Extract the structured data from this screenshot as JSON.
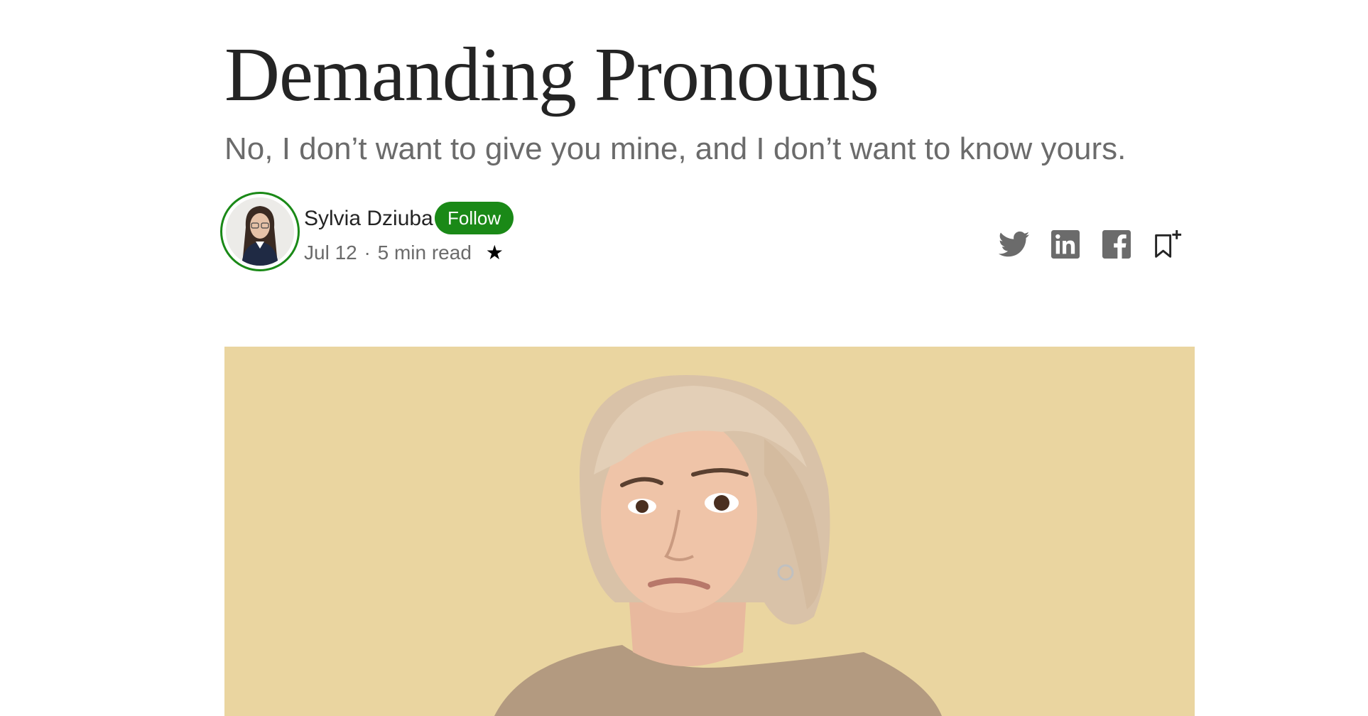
{
  "article": {
    "title": "Demanding Pronouns",
    "subtitle": "No, I don’t want to give you mine, and I don’t want to know yours."
  },
  "author": {
    "name": "Sylvia Dziuba",
    "follow_label": "Follow",
    "date": "Jul 12",
    "separator": "·",
    "read_time": "5 min read",
    "member_star": "★"
  },
  "share": {
    "icons": [
      "twitter-icon",
      "linkedin-icon",
      "facebook-icon",
      "bookmark-add-icon"
    ]
  },
  "colors": {
    "accent_green": "#1a8917",
    "title_text": "#242424",
    "subtitle_text": "#6b6b6b",
    "icon_gray": "#6b6b6b",
    "hero_background": "#ead5a0"
  }
}
